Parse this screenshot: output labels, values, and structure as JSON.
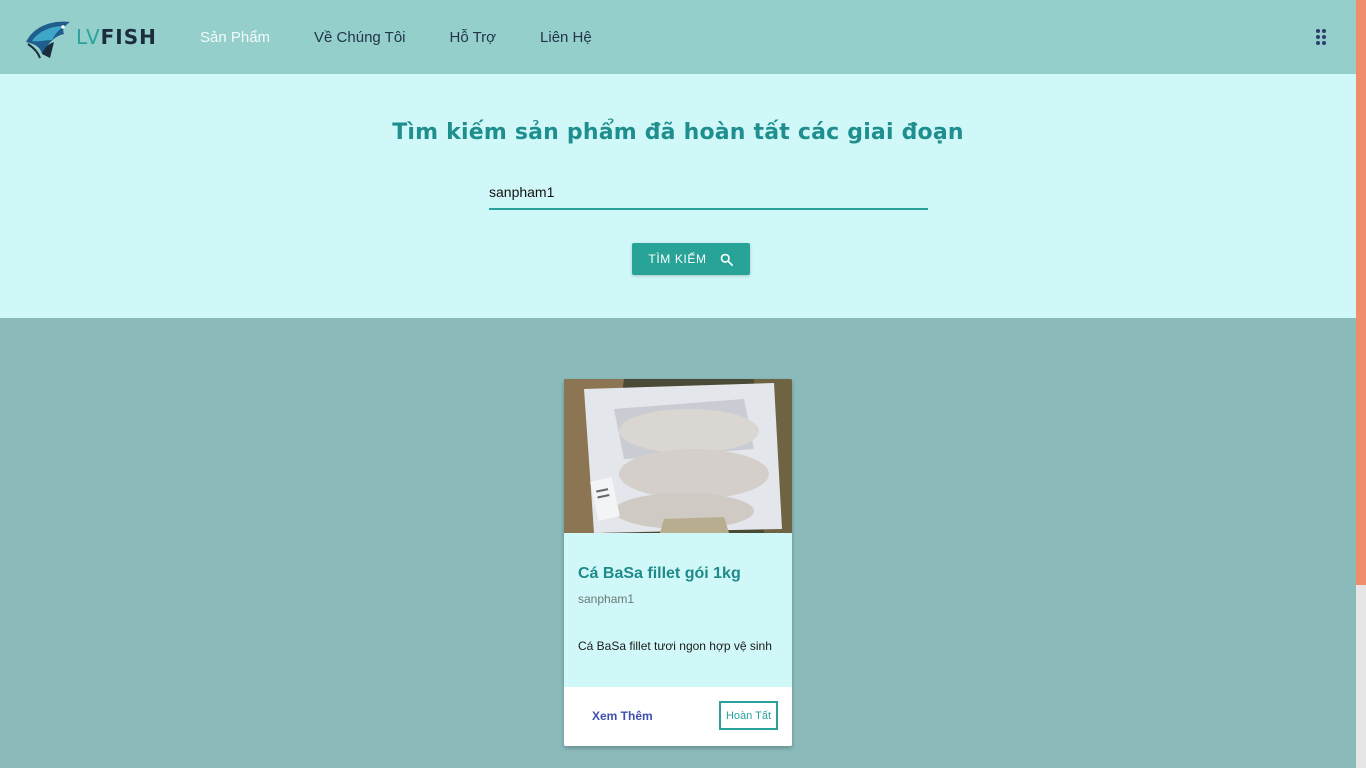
{
  "brand": {
    "lv": "LV",
    "fish": "FISH"
  },
  "nav": [
    {
      "label": "Sản Phẩm"
    },
    {
      "label": "Về Chúng Tôi"
    },
    {
      "label": "Hỗ Trợ"
    },
    {
      "label": "Liên Hệ"
    }
  ],
  "hero": {
    "title": "Tìm kiếm sản phẩm đã hoàn tất các giai đoạn",
    "search_value": "sanpham1",
    "search_button": "TÌM KIẾM"
  },
  "card": {
    "title": "Cá BaSa fillet gói 1kg",
    "code": "sanpham1",
    "description": "Cá BaSa fillet tươi ngon hợp vệ sinh",
    "more_label": "Xem Thêm",
    "status_label": "Hoàn Tất"
  },
  "colors": {
    "navbar": "#94cfcb",
    "hero": "#d1f8f8",
    "page": "#8ababa",
    "accent": "#28a397",
    "scroll_thumb": "#f08d6c"
  },
  "icons": [
    "fish-logo-icon",
    "apps-grid-icon",
    "search-icon"
  ]
}
